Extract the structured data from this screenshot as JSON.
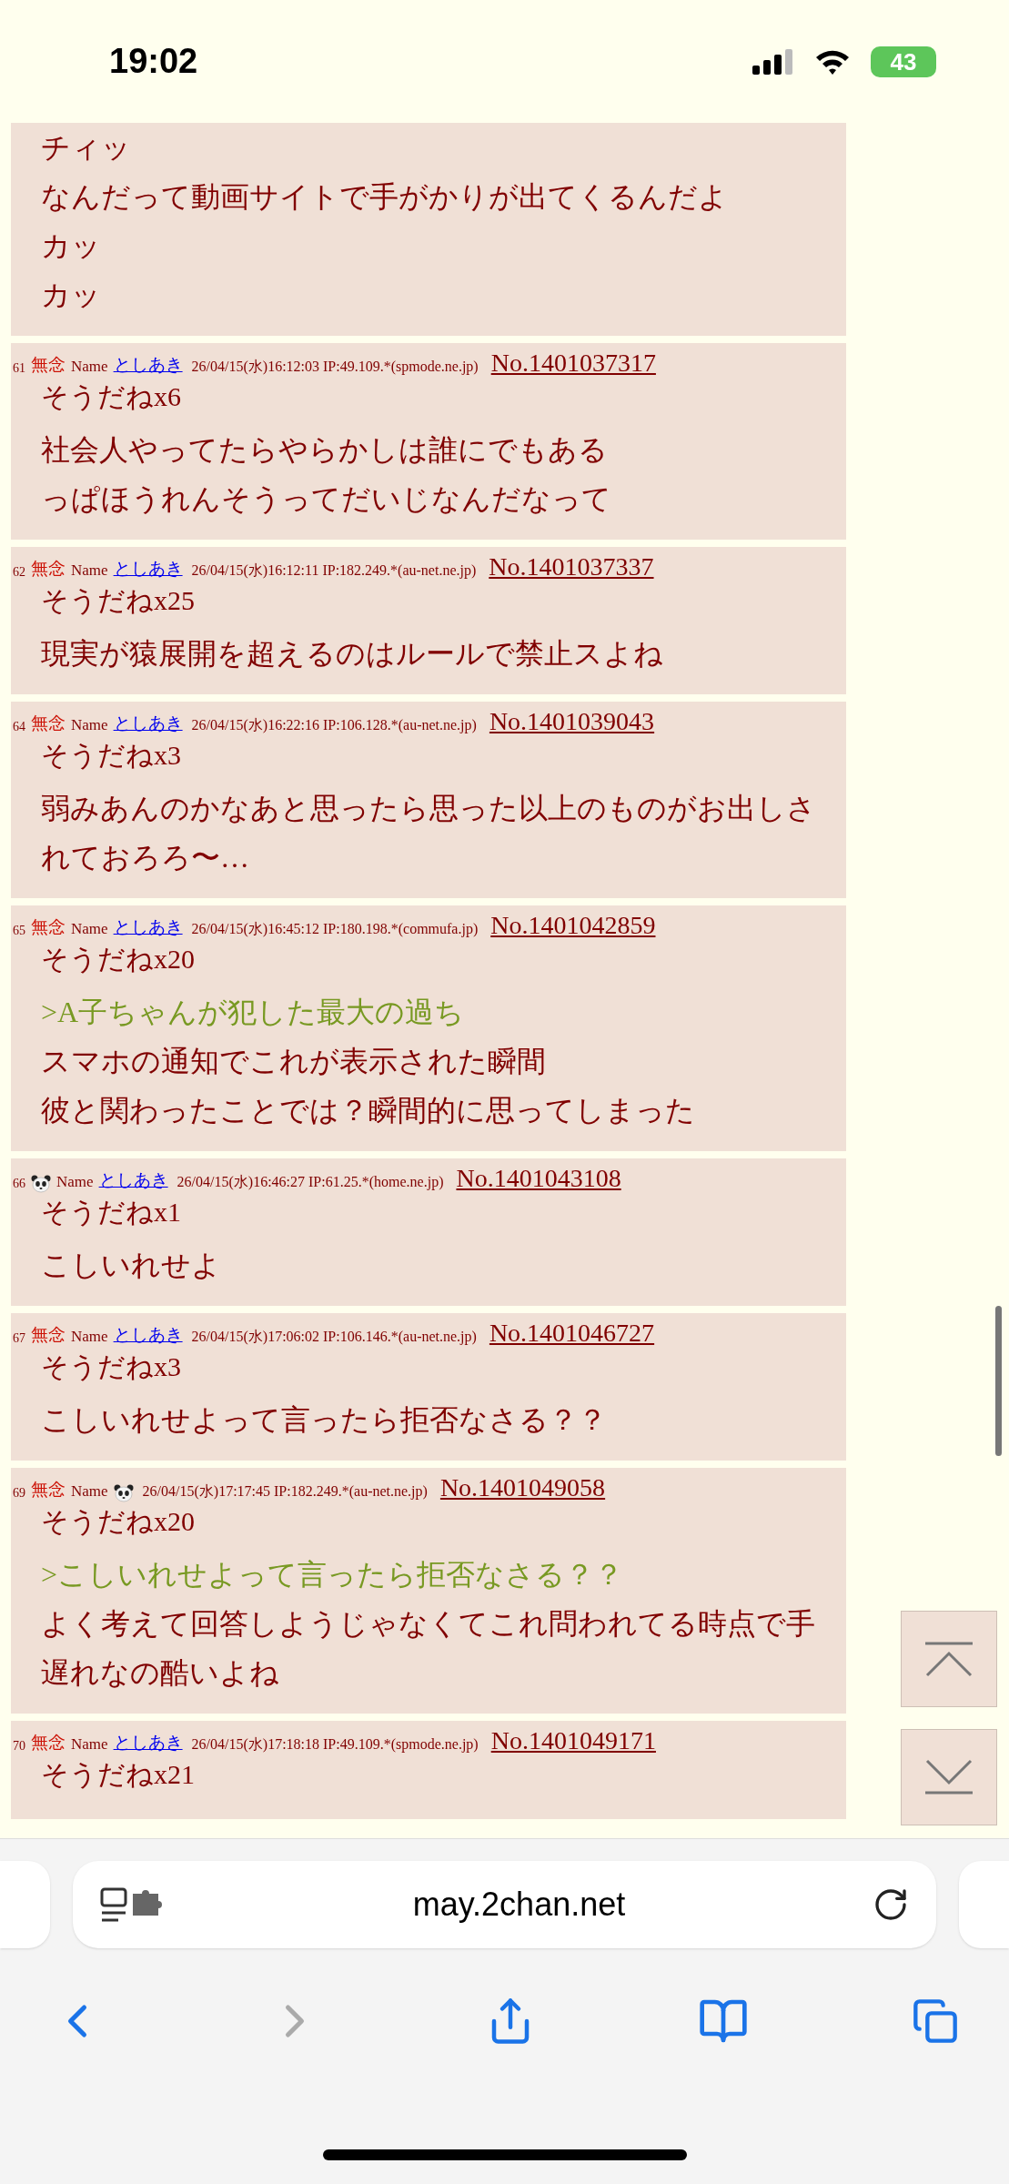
{
  "status_bar": {
    "time": "19:02",
    "battery": "43"
  },
  "posts": [
    {
      "lines": [
        {
          "kind": "text",
          "text": "チィッ"
        },
        {
          "kind": "text",
          "text": "なんだって動画サイトで手がかりが出てくるんだよ"
        },
        {
          "kind": "text",
          "text": "カッ"
        },
        {
          "kind": "text",
          "text": "カッ"
        }
      ]
    },
    {
      "index": "61",
      "subject": {
        "kind": "text",
        "text": "無念"
      },
      "name_label": "Name",
      "name": {
        "kind": "link",
        "text": "としあき"
      },
      "date": "26/04/15(水)16:12:03 IP:49.109.*(spmode.ne.jp)",
      "number": "No.1401037317",
      "sodane": "そうだねx6",
      "lines": [
        {
          "kind": "text",
          "text": "社会人やってたらやらかしは誰にでもある"
        },
        {
          "kind": "text",
          "text": "っぱほうれんそうってだいじなんだなって"
        }
      ]
    },
    {
      "index": "62",
      "subject": {
        "kind": "text",
        "text": "無念"
      },
      "name_label": "Name",
      "name": {
        "kind": "link",
        "text": "としあき"
      },
      "date": "26/04/15(水)16:12:11 IP:182.249.*(au-net.ne.jp)",
      "number": "No.1401037337",
      "sodane": "そうだねx25",
      "lines": [
        {
          "kind": "text",
          "text": "現実が猿展開を超えるのはルールで禁止スよね"
        }
      ]
    },
    {
      "index": "64",
      "subject": {
        "kind": "text",
        "text": "無念"
      },
      "name_label": "Name",
      "name": {
        "kind": "link",
        "text": "としあき"
      },
      "date": "26/04/15(水)16:22:16 IP:106.128.*(au-net.ne.jp)",
      "number": "No.1401039043",
      "sodane": "そうだねx3",
      "lines": [
        {
          "kind": "text",
          "text": "弱みあんのかなあと思ったら思った以上のものがお出しされておろろ〜…"
        }
      ]
    },
    {
      "index": "65",
      "subject": {
        "kind": "text",
        "text": "無念"
      },
      "name_label": "Name",
      "name": {
        "kind": "link",
        "text": "としあき"
      },
      "date": "26/04/15(水)16:45:12 IP:180.198.*(commufa.jp)",
      "number": "No.1401042859",
      "sodane": "そうだねx20",
      "lines": [
        {
          "kind": "quote",
          "text": ">A子ちゃんが犯した最大の過ち"
        },
        {
          "kind": "text",
          "text": "スマホの通知でこれが表示された瞬間"
        },
        {
          "kind": "text",
          "text": "彼と関わったことでは？瞬間的に思ってしまった"
        }
      ]
    },
    {
      "index": "66",
      "subject": {
        "kind": "icon"
      },
      "name_label": "Name",
      "name": {
        "kind": "link",
        "text": "としあき"
      },
      "date": "26/04/15(水)16:46:27 IP:61.25.*(home.ne.jp)",
      "number": "No.1401043108",
      "sodane": "そうだねx1",
      "lines": [
        {
          "kind": "text",
          "text": "こしいれせよ"
        }
      ]
    },
    {
      "index": "67",
      "subject": {
        "kind": "text",
        "text": "無念"
      },
      "name_label": "Name",
      "name": {
        "kind": "link",
        "text": "としあき"
      },
      "date": "26/04/15(水)17:06:02 IP:106.146.*(au-net.ne.jp)",
      "number": "No.1401046727",
      "sodane": "そうだねx3",
      "lines": [
        {
          "kind": "text",
          "text": "こしいれせよって言ったら拒否なさる？？"
        }
      ]
    },
    {
      "index": "69",
      "subject": {
        "kind": "text",
        "text": "無念"
      },
      "name_label": "Name",
      "name": {
        "kind": "icon"
      },
      "date": "26/04/15(水)17:17:45 IP:182.249.*(au-net.ne.jp)",
      "number": "No.1401049058",
      "sodane": "そうだねx20",
      "lines": [
        {
          "kind": "quote",
          "text": ">こしいれせよって言ったら拒否なさる？？"
        },
        {
          "kind": "text",
          "text": "よく考えて回答しようじゃなくてこれ問われてる時点で手遅れなの酷いよね"
        }
      ]
    },
    {
      "index": "70",
      "subject": {
        "kind": "text",
        "text": "無念"
      },
      "name_label": "Name",
      "name": {
        "kind": "link",
        "text": "としあき"
      },
      "date": "26/04/15(水)17:18:18 IP:49.109.*(spmode.ne.jp)",
      "number": "No.1401049171",
      "sodane": "そうだねx21"
    }
  ],
  "browser": {
    "url": "may.2chan.net",
    "back_disabled": false,
    "forward_disabled": true
  }
}
